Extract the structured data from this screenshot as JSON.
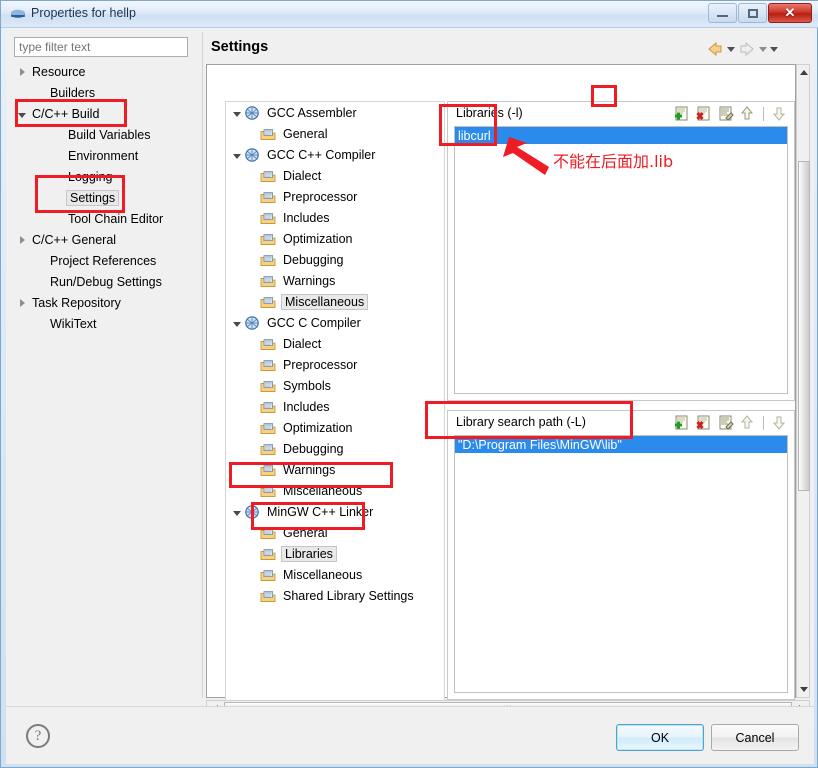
{
  "window": {
    "title": "Properties for hellp",
    "icon": "eclipse-properties-icon",
    "buttons": {
      "minimize": "minimize-icon",
      "maximize": "maximize-icon",
      "close": "✕"
    }
  },
  "filter": {
    "placeholder": "type filter text",
    "value": ""
  },
  "nav_tree": [
    {
      "label": "Resource",
      "indent": 0,
      "arrow": "collapsed",
      "selected": false
    },
    {
      "label": "Builders",
      "indent": 1,
      "arrow": "none",
      "selected": false
    },
    {
      "label": "C/C++ Build",
      "indent": 0,
      "arrow": "expanded",
      "selected": false
    },
    {
      "label": "Build Variables",
      "indent": 2,
      "arrow": "none",
      "selected": false
    },
    {
      "label": "Environment",
      "indent": 2,
      "arrow": "none",
      "selected": false
    },
    {
      "label": "Logging",
      "indent": 2,
      "arrow": "none",
      "selected": false
    },
    {
      "label": "Settings",
      "indent": 2,
      "arrow": "none",
      "selected": true
    },
    {
      "label": "Tool Chain Editor",
      "indent": 2,
      "arrow": "none",
      "selected": false
    },
    {
      "label": "C/C++ General",
      "indent": 0,
      "arrow": "collapsed",
      "selected": false
    },
    {
      "label": "Project References",
      "indent": 1,
      "arrow": "none",
      "selected": false
    },
    {
      "label": "Run/Debug Settings",
      "indent": 1,
      "arrow": "none",
      "selected": false
    },
    {
      "label": "Task Repository",
      "indent": 0,
      "arrow": "collapsed",
      "selected": false
    },
    {
      "label": "WikiText",
      "indent": 1,
      "arrow": "none",
      "selected": false
    }
  ],
  "settings": {
    "title": "Settings",
    "nav": {
      "back": "back-arrow-icon",
      "back_menu": "chevron-down-icon",
      "forward": "forward-arrow-icon",
      "forward_menu": "chevron-down-icon",
      "view_menu": "chevron-down-icon"
    }
  },
  "tool_tree": [
    {
      "label": "GCC Assembler",
      "indent": 0,
      "arrow": "expanded",
      "icon": "toolchain-icon",
      "selected": false
    },
    {
      "label": "General",
      "indent": 1,
      "arrow": "none",
      "icon": "folder-tool-icon",
      "selected": false
    },
    {
      "label": "GCC C++ Compiler",
      "indent": 0,
      "arrow": "expanded",
      "icon": "toolchain-icon",
      "selected": false
    },
    {
      "label": "Dialect",
      "indent": 1,
      "arrow": "none",
      "icon": "folder-tool-icon",
      "selected": false
    },
    {
      "label": "Preprocessor",
      "indent": 1,
      "arrow": "none",
      "icon": "folder-tool-icon",
      "selected": false
    },
    {
      "label": "Includes",
      "indent": 1,
      "arrow": "none",
      "icon": "folder-tool-icon",
      "selected": false
    },
    {
      "label": "Optimization",
      "indent": 1,
      "arrow": "none",
      "icon": "folder-tool-icon",
      "selected": false
    },
    {
      "label": "Debugging",
      "indent": 1,
      "arrow": "none",
      "icon": "folder-tool-icon",
      "selected": false
    },
    {
      "label": "Warnings",
      "indent": 1,
      "arrow": "none",
      "icon": "folder-tool-icon",
      "selected": false
    },
    {
      "label": "Miscellaneous",
      "indent": 1,
      "arrow": "none",
      "icon": "folder-tool-icon",
      "selected": true
    },
    {
      "label": "GCC C Compiler",
      "indent": 0,
      "arrow": "expanded",
      "icon": "toolchain-icon",
      "selected": false
    },
    {
      "label": "Dialect",
      "indent": 1,
      "arrow": "none",
      "icon": "folder-tool-icon",
      "selected": false
    },
    {
      "label": "Preprocessor",
      "indent": 1,
      "arrow": "none",
      "icon": "folder-tool-icon",
      "selected": false
    },
    {
      "label": "Symbols",
      "indent": 1,
      "arrow": "none",
      "icon": "folder-tool-icon",
      "selected": false
    },
    {
      "label": "Includes",
      "indent": 1,
      "arrow": "none",
      "icon": "folder-tool-icon",
      "selected": false
    },
    {
      "label": "Optimization",
      "indent": 1,
      "arrow": "none",
      "icon": "folder-tool-icon",
      "selected": false
    },
    {
      "label": "Debugging",
      "indent": 1,
      "arrow": "none",
      "icon": "folder-tool-icon",
      "selected": false
    },
    {
      "label": "Warnings",
      "indent": 1,
      "arrow": "none",
      "icon": "folder-tool-icon",
      "selected": false
    },
    {
      "label": "Miscellaneous",
      "indent": 1,
      "arrow": "none",
      "icon": "folder-tool-icon",
      "selected": false
    },
    {
      "label": "MinGW C++ Linker",
      "indent": 0,
      "arrow": "expanded",
      "icon": "toolchain-icon",
      "selected": false
    },
    {
      "label": "General",
      "indent": 1,
      "arrow": "none",
      "icon": "folder-tool-icon",
      "selected": false
    },
    {
      "label": "Libraries",
      "indent": 1,
      "arrow": "none",
      "icon": "folder-tool-icon",
      "selected": true
    },
    {
      "label": "Miscellaneous",
      "indent": 1,
      "arrow": "none",
      "icon": "folder-tool-icon",
      "selected": false
    },
    {
      "label": "Shared Library Settings",
      "indent": 1,
      "arrow": "none",
      "icon": "folder-tool-icon",
      "selected": false
    }
  ],
  "libraries_group": {
    "label": "Libraries (-l)",
    "toolbar": [
      "add-icon",
      "delete-icon",
      "edit-icon",
      "move-up-icon",
      "move-down-icon"
    ],
    "items": [
      "libcurl"
    ],
    "selected_item": "libcurl"
  },
  "search_path_group": {
    "label": "Library search path (-L)",
    "toolbar": [
      "add-icon",
      "delete-icon",
      "edit-icon",
      "move-up-icon",
      "move-down-icon"
    ],
    "items": [
      "\"D:\\Program Files\\MinGW\\lib\""
    ],
    "selected_item": "\"D:\\Program Files\\MinGW\\lib\""
  },
  "annotation": {
    "note": "不能在后面加.lib",
    "color": "#ee1c24",
    "boxes": [
      "c-cpp-build-highlight",
      "settings-highlight",
      "mingw-linker-highlight",
      "libraries-highlight",
      "libcurl-highlight",
      "add-library-button-highlight",
      "search-path-value-highlight"
    ]
  },
  "footer": {
    "help": "?",
    "ok_label": "OK",
    "cancel_label": "Cancel"
  },
  "scrollbars": {
    "pane_vertical": "vertical-scrollbar",
    "pane_horizontal": "horizontal-scrollbar"
  }
}
